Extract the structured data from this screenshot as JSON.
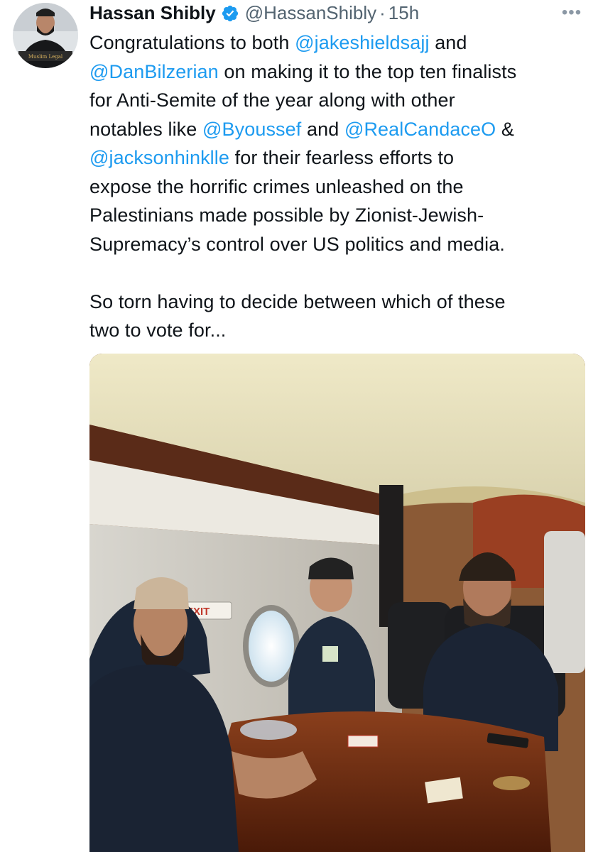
{
  "author": {
    "name": "Hassan Shibly",
    "handle": "@HassanShibly",
    "separator": "·",
    "time": "15h",
    "verified": true,
    "avatar_logo_text": "Muslim Legal"
  },
  "menu": {
    "more_icon": "more-horizontal-icon"
  },
  "tweet": {
    "line1_pre": "Congratulations to both ",
    "mention_jake": "@jakeshieldsajj",
    "line1_post": " and",
    "mention_dan": "@DanBilzerian",
    "line2_post": " on making it to the top ten finalists",
    "line3": "for Anti-Semite of the year along with other",
    "line4_pre": "notables like ",
    "mention_byoussef": "@Byoussef",
    "line4_mid": " and ",
    "mention_candace": "@RealCandaceO",
    "line4_post": " &",
    "mention_jackson": "@jacksonhinklle",
    "line5_post": " for their fearless efforts to",
    "line6": "expose the horrific crimes unleashed on the",
    "line7": "Palestinians made possible by Zionist-Jewish-",
    "line8": "Supremacy’s control over US politics and media.",
    "para2_line1": "So torn having to decide between which of these",
    "para2_line2": "two to vote for..."
  },
  "colors": {
    "mention": "#1d9bf0",
    "secondary_text": "#536471",
    "verified_badge": "#1d9bf0"
  },
  "media": {
    "exit_sign": "EXIT"
  }
}
